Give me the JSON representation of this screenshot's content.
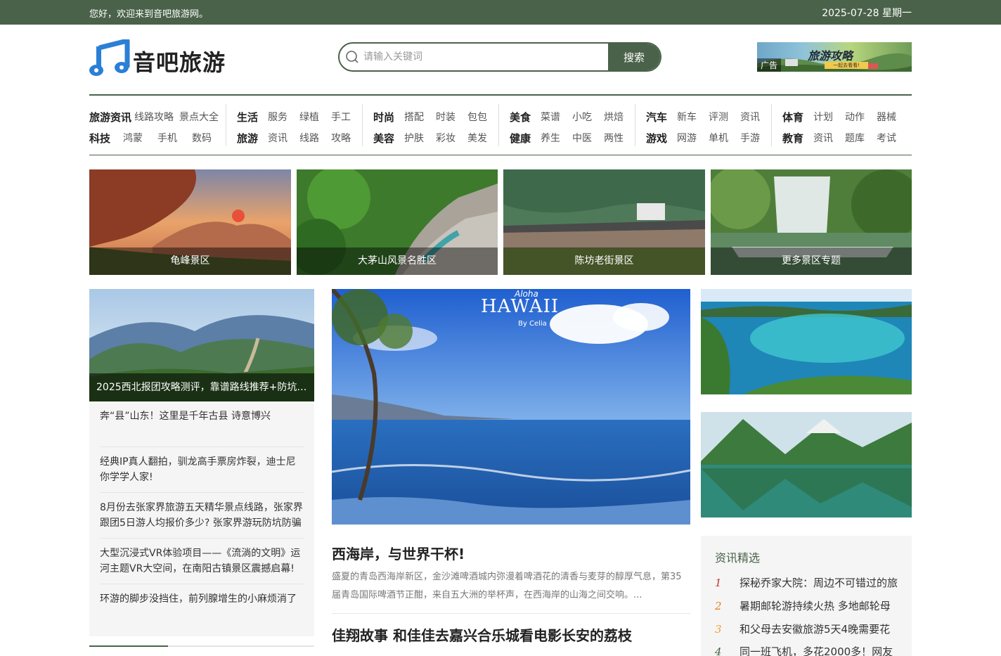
{
  "topbar": {
    "welcome": "您好，欢迎来到音吧旅游网。",
    "date": "2025-07-28 星期一"
  },
  "logo": {
    "text": "音吧旅游"
  },
  "search": {
    "placeholder": "请输入关键词",
    "button": "搜索"
  },
  "ad": {
    "title": "旅游攻略",
    "subtitle": "一起去看看!",
    "label": "广告"
  },
  "nav": [
    {
      "rows": [
        [
          "旅游资讯",
          "线路攻略",
          "景点大全"
        ],
        [
          "科技",
          "鸿蒙",
          "手机",
          "数码"
        ]
      ]
    },
    {
      "rows": [
        [
          "生活",
          "服务",
          "绿植",
          "手工"
        ],
        [
          "旅游",
          "资讯",
          "线路",
          "攻略"
        ]
      ]
    },
    {
      "rows": [
        [
          "时尚",
          "搭配",
          "时装",
          "包包"
        ],
        [
          "美容",
          "护肤",
          "彩妆",
          "美发"
        ]
      ]
    },
    {
      "rows": [
        [
          "美食",
          "菜谱",
          "小吃",
          "烘焙"
        ],
        [
          "健康",
          "养生",
          "中医",
          "两性"
        ]
      ]
    },
    {
      "rows": [
        [
          "汽车",
          "新车",
          "评测",
          "资讯"
        ],
        [
          "游戏",
          "网游",
          "单机",
          "手游"
        ]
      ]
    },
    {
      "rows": [
        [
          "体育",
          "计划",
          "动作",
          "器械"
        ],
        [
          "教育",
          "资讯",
          "题库",
          "考试"
        ]
      ]
    }
  ],
  "tiles": [
    "龟峰景区",
    "大茅山风景名胜区",
    "陈坊老街景区",
    "更多景区专题"
  ],
  "left": {
    "hero_caption": "2025西北报团攻略测评，靠谱路线推荐+防坑指南",
    "items": [
      "奔“县”山东！这里是千年古县 诗意博兴",
      "经典IP真人翻拍，驯龙高手票房炸裂，迪士尼你学学人家!",
      "8月份去张家界旅游五天精华景点线路，张家界跟团5日游人均报价多少? 张家界游玩防坑防骗",
      "大型沉浸式VR体验项目——《流淌的文明》运河主题VR大空间，在南阳古镇景区震撼启幕!",
      "环游的脚步没挡住，前列腺增生的小麻烦消了"
    ]
  },
  "center": {
    "image_text": {
      "aloha": "Aloha",
      "hawaii": "HAWAII",
      "by": "By Celia"
    },
    "headline1": "西海岸，与世界干杯!",
    "summary": "盛夏的青岛西海岸新区，金沙滩啤酒城内弥漫着啤酒花的清香与麦芽的醇厚气息，第35届青岛国际啤酒节正酣，来自五大洲的举杯声，在西海岸的山海之间交响。...",
    "headline2": "佳翔故事 和佳佳去嘉兴合乐城看电影长安的荔枝"
  },
  "news": {
    "title": "资讯精选",
    "items": [
      {
        "num": "1",
        "text": "探秘乔家大院：周边不可错过的旅",
        "color": "#c0392b"
      },
      {
        "num": "2",
        "text": "暑期邮轮游持续火热 多地邮轮母",
        "color": "#e67e22"
      },
      {
        "num": "3",
        "text": "和父母去安徽旅游5天4晚需要花",
        "color": "#f0a030"
      },
      {
        "num": "4",
        "text": "同一班飞机，多花2000多！网友",
        "color": "#4a6249"
      }
    ]
  },
  "colors": {
    "accent": "#4a6249"
  }
}
